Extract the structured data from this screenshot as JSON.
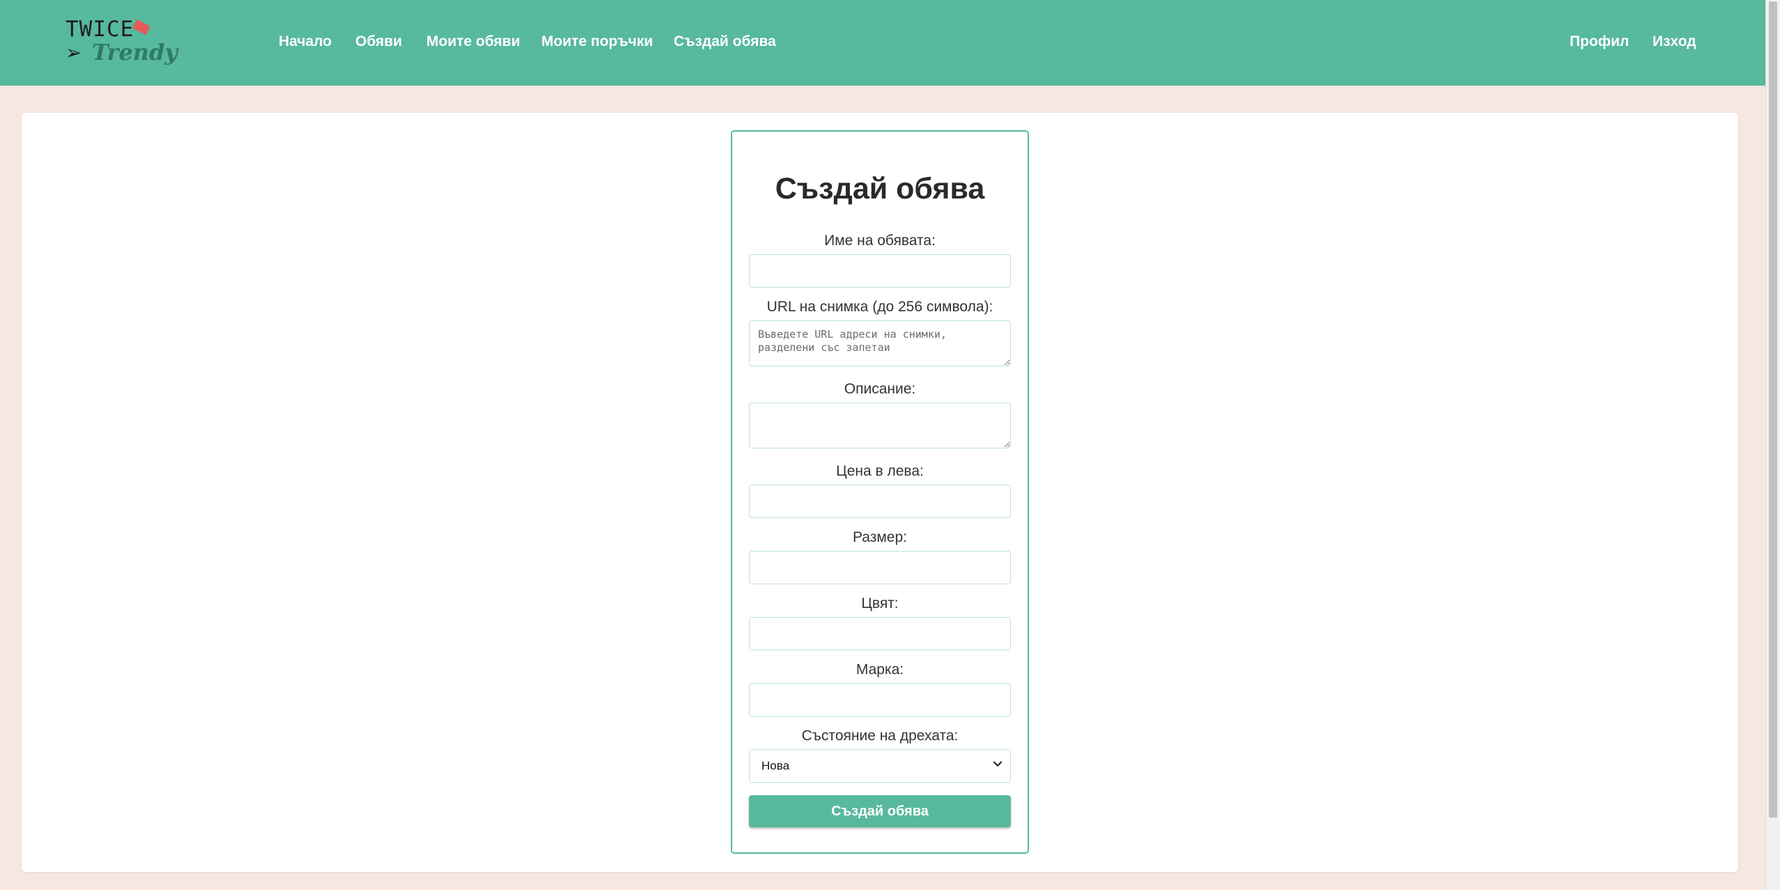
{
  "brand": {
    "logo_top": "TWICE",
    "logo_bottom": "Trendy"
  },
  "nav": {
    "left": [
      "Начало",
      "Обяви",
      "Моите обяви",
      "Моите поръчки",
      "Създай обява"
    ],
    "right": [
      "Профил",
      "Изход"
    ]
  },
  "form": {
    "title": "Създай обява",
    "name_label": "Име на обявата:",
    "url_label": "URL на снимка (до 256 символа):",
    "url_placeholder": "Въведете URL адреси на снимки, разделени със запетаи",
    "description_label": "Описание:",
    "price_label": "Цена в лева:",
    "size_label": "Размер:",
    "color_label": "Цвят:",
    "brand_label": "Марка:",
    "condition_label": "Състояние на дрехата:",
    "condition_value": "Нова",
    "submit_label": "Създай обява"
  },
  "colors": {
    "accent": "#57b99d",
    "page_background": "#f8e6e0",
    "logo_tag": "#e35b5b"
  }
}
